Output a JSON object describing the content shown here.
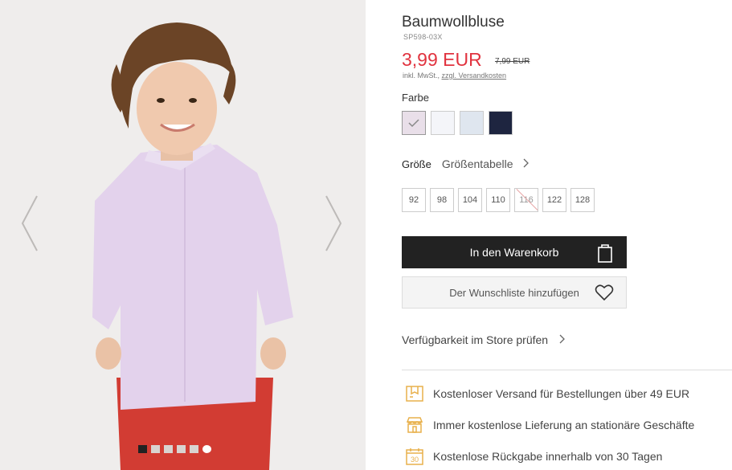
{
  "gallery": {
    "prev_icon": "chevron-left-icon",
    "next_icon": "chevron-right-icon",
    "dots_count": 6,
    "active_dot": 0
  },
  "product": {
    "title": "Baumwollbluse",
    "sku": "SP598-03X",
    "price": "3,99 EUR",
    "old_price": "7,99 EUR",
    "tax_text": "inkl. MwSt., ",
    "shipping_link": "zzgl. Versandkosten",
    "price_color": "#e1333f"
  },
  "color": {
    "label": "Farbe",
    "swatches": [
      {
        "name": "lila",
        "color": "#e9dfe9",
        "selected": true
      },
      {
        "name": "weiß",
        "color": "#f4f5f9",
        "selected": false
      },
      {
        "name": "hellblau",
        "color": "#dfe6ef",
        "selected": false
      },
      {
        "name": "dunkelblau",
        "color": "#1e2540",
        "selected": false
      }
    ]
  },
  "size": {
    "label": "Größe",
    "table_link": "Größentabelle",
    "options": [
      {
        "label": "92",
        "available": true
      },
      {
        "label": "98",
        "available": true
      },
      {
        "label": "104",
        "available": true
      },
      {
        "label": "110",
        "available": true
      },
      {
        "label": "116",
        "available": false
      },
      {
        "label": "122",
        "available": true
      },
      {
        "label": "128",
        "available": true
      }
    ]
  },
  "actions": {
    "cart_label": "In den Warenkorb",
    "cart_icon": "shopping-bag-icon",
    "wishlist_label": "Der Wunschliste hinzufügen",
    "wishlist_icon": "heart-icon",
    "store_check_label": "Verfügbarkeit im Store prüfen"
  },
  "benefits": [
    {
      "icon": "delivery-box-icon",
      "text": "Kostenloser Versand für Bestellungen über 49 EUR"
    },
    {
      "icon": "store-icon",
      "text": "Immer kostenlose Lieferung an stationäre Geschäfte"
    },
    {
      "icon": "calendar-30-icon",
      "text": "Kostenlose Rückgabe innerhalb von 30 Tagen"
    }
  ],
  "accent_color": "#e8b04b"
}
